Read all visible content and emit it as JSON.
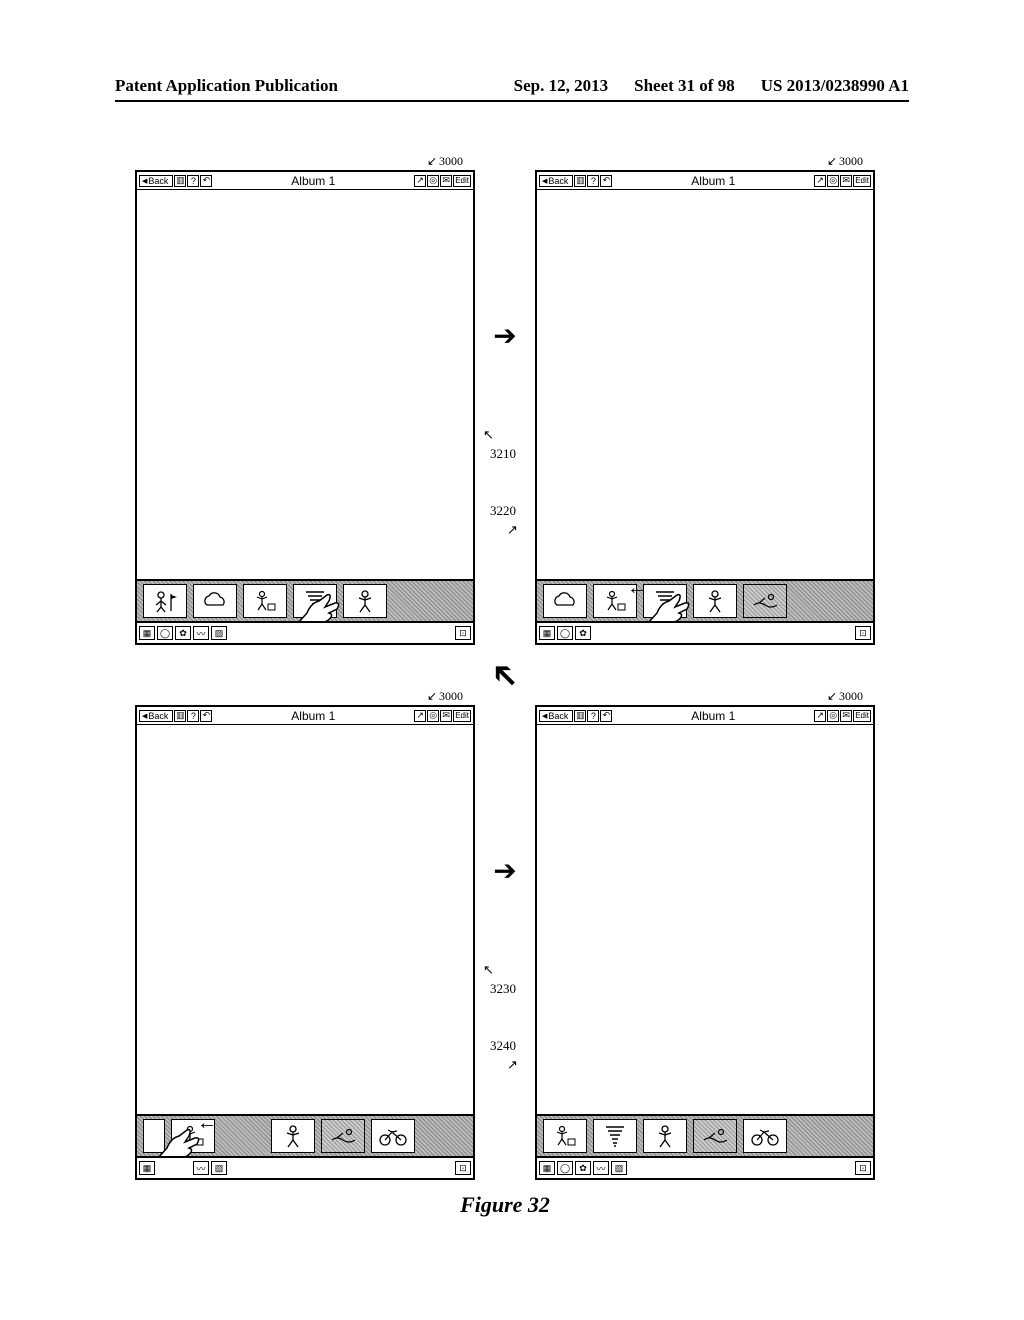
{
  "header": {
    "left": "Patent Application Publication",
    "date": "Sep. 12, 2013",
    "sheet": "Sheet 31 of 98",
    "pubno": "US 2013/0238990 A1"
  },
  "figure_caption": "Figure 32",
  "callouts": {
    "device": "3000",
    "a": "3210",
    "b": "3220",
    "c": "3230",
    "d": "3240"
  },
  "toolbar": {
    "back": "Back",
    "title": "Album 1",
    "edit": "Edit"
  },
  "icons": {
    "person_flag": "person-flag-icon",
    "cloud": "cloud-icon",
    "person_sub": "person-sub-icon",
    "tornado": "tornado-icon",
    "person": "person-icon",
    "swim": "swimmer-icon",
    "bike": "bike-icon",
    "grid": "grid-icon",
    "gear": "gear-icon",
    "globe": "globe-icon",
    "wave": "wave-icon",
    "puzzle": "puzzle-icon",
    "mail": "mail-icon",
    "undo": "undo-icon",
    "help": "help-icon",
    "columns": "columns-icon",
    "photo": "photo-icon",
    "export": "export-icon"
  }
}
